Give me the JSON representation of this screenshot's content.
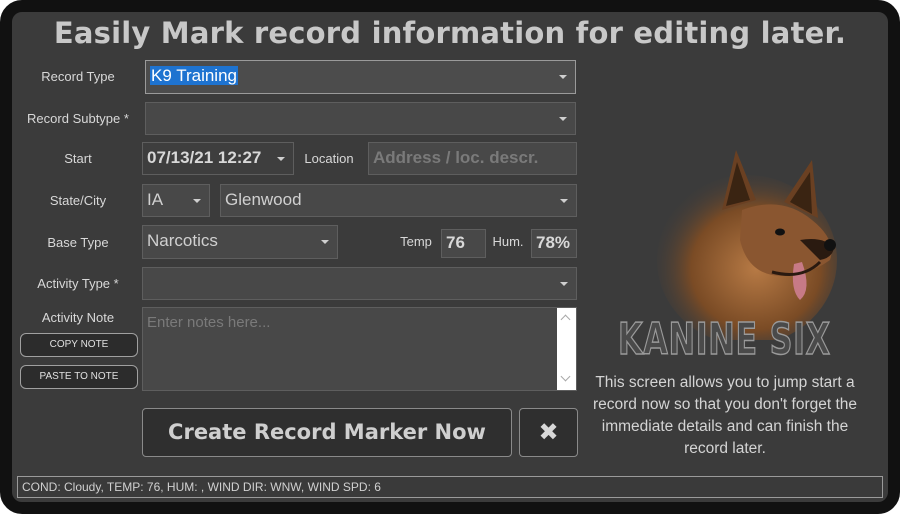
{
  "title": "Easily Mark record information for editing later.",
  "form": {
    "record_type": {
      "label": "Record Type",
      "value": "K9 Training"
    },
    "record_subtype": {
      "label": "Record Subtype *",
      "value": ""
    },
    "start": {
      "label": "Start",
      "value": "07/13/21 12:27"
    },
    "location": {
      "label": "Location",
      "placeholder": "Address / loc. descr."
    },
    "state_city": {
      "label": "State/City",
      "state": "IA",
      "city": "Glenwood"
    },
    "base_type": {
      "label": "Base Type",
      "value": "Narcotics"
    },
    "temp": {
      "label": "Temp",
      "value": "76"
    },
    "hum": {
      "label": "Hum.",
      "value": "78%"
    },
    "activity_type": {
      "label": "Activity Type *",
      "value": ""
    },
    "activity_note": {
      "label": "Activity Note",
      "placeholder": "Enter notes here..."
    }
  },
  "buttons": {
    "copy_note": "COPY NOTE",
    "paste_to_note": "PASTE TO NOTE",
    "create": "Create Record Marker Now",
    "close": "✖"
  },
  "brand": "KANINE SIX",
  "description": "This screen allows you to jump start a record now so that you don't forget the immediate details and can finish the record later.",
  "status_bar": "COND: Cloudy, TEMP: 76, HUM: , WIND DIR: WNW, WIND SPD: 6",
  "colors": {
    "background": "#3b3b3b",
    "frame": "#111111",
    "selection": "#1e73d0"
  },
  "icons": {
    "dog_image": "german-shepherd-dog-icon",
    "dropdown": "chevron-down-icon"
  }
}
